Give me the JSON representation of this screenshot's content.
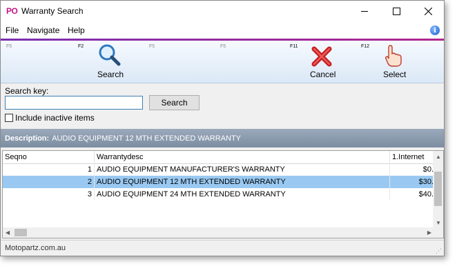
{
  "window": {
    "app_logo": "PO",
    "title": "Warranty Search"
  },
  "menu": {
    "items": [
      "File",
      "Navigate",
      "Help"
    ]
  },
  "toolbar": {
    "fkeys": [
      "F5",
      "F2",
      "F5",
      "F5",
      "F11",
      "F12"
    ],
    "search_label": "Search",
    "cancel_label": "Cancel",
    "select_label": "Select"
  },
  "search": {
    "label": "Search key:",
    "value": "",
    "button_label": "Search",
    "include_inactive_label": "Include inactive items",
    "include_inactive_checked": false
  },
  "description": {
    "label": "Description:",
    "value": "AUDIO EQUIPMENT 12 MTH EXTENDED WARRANTY"
  },
  "grid": {
    "columns": [
      "Seqno",
      "Warrantydesc",
      "1.Internet"
    ],
    "rows": [
      {
        "seqno": "1",
        "desc": "AUDIO EQUIPMENT MANUFACTURER'S WARRANTY",
        "price": "$0.",
        "selected": false
      },
      {
        "seqno": "2",
        "desc": "AUDIO EQUIPMENT 12 MTH EXTENDED WARRANTY",
        "price": "$30.",
        "selected": true
      },
      {
        "seqno": "3",
        "desc": "AUDIO EQUIPMENT 24 MTH EXTENDED WARRANTY",
        "price": "$40.",
        "selected": false
      }
    ]
  },
  "status": {
    "text": "Motopartz.com.au"
  }
}
